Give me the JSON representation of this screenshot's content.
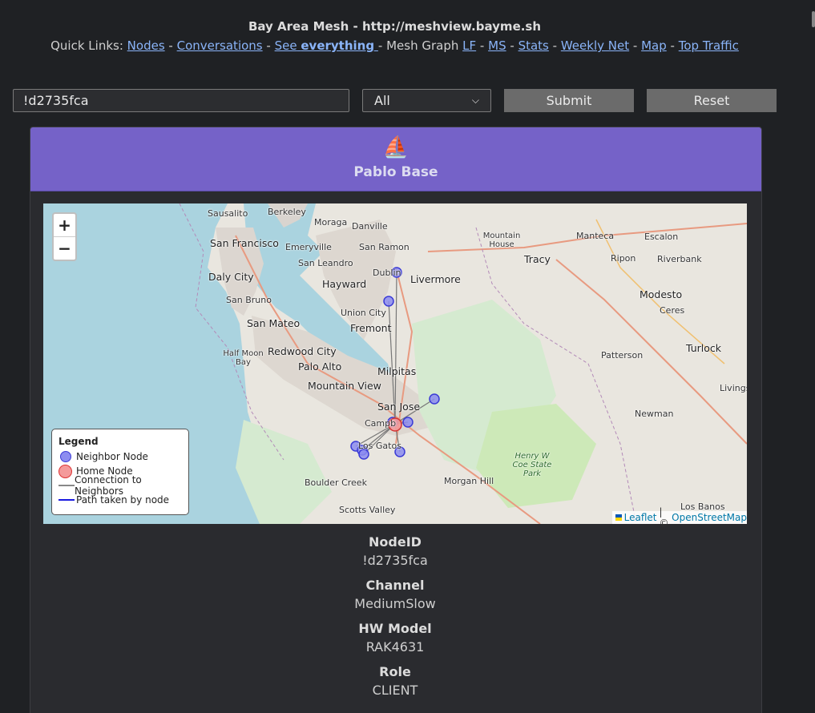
{
  "site": {
    "title": "Bay Area Mesh - http://meshview.bayme.sh",
    "quick_links_label": "Quick Links:",
    "links": {
      "nodes": "Nodes",
      "conversations": "Conversations",
      "see": "See",
      "everything": "everything",
      "mesh_graph": "Mesh Graph",
      "lf": "LF",
      "ms": "MS",
      "stats": "Stats",
      "weekly_net": "Weekly Net",
      "map": "Map",
      "top_traffic": "Top Traffic"
    },
    "separator": "-"
  },
  "search": {
    "value": "!d2735fca",
    "channel_selected": "All",
    "submit_label": "Submit",
    "reset_label": "Reset"
  },
  "node": {
    "icon": "⛵",
    "name": "Pablo Base",
    "fields": [
      {
        "label": "NodeID",
        "value": "!d2735fca"
      },
      {
        "label": "Channel",
        "value": "MediumSlow"
      },
      {
        "label": "HW Model",
        "value": "RAK4631"
      },
      {
        "label": "Role",
        "value": "CLIENT"
      }
    ]
  },
  "map": {
    "zoom_in": "+",
    "zoom_out": "−",
    "places": {
      "sausalito": "Sausalito",
      "berkeley": "Berkeley",
      "moraga": "Moraga",
      "danville": "Danville",
      "manteca": "Manteca",
      "escalon": "Escalon",
      "mountain_house": "Mountain House",
      "san_francisco": "San Francisco",
      "emeryville": "Emeryville",
      "san_ramon": "San Ramon",
      "tracy": "Tracy",
      "ripon": "Ripon",
      "riverbank": "Riverbank",
      "san_leandro": "San Leandro",
      "daly_city": "Daly City",
      "dublin": "Dublin",
      "livermore": "Livermore",
      "hayward": "Hayward",
      "modesto": "Modesto",
      "san_bruno": "San Bruno",
      "ceres": "Ceres",
      "union_city": "Union City",
      "san_mateo": "San Mateo",
      "fremont": "Fremont",
      "redwood_city": "Redwood City",
      "half_moon_bay": "Half Moon Bay",
      "turlock": "Turlock",
      "patterson": "Patterson",
      "palo_alto": "Palo Alto",
      "milpitas": "Milpitas",
      "mountain_view": "Mountain View",
      "livingston": "Livingst",
      "san_jose": "San Jose",
      "newman": "Newman",
      "campbell": "Campb",
      "los_gatos": "Los Gatos",
      "henry_coe": "Henry W Coe State Park",
      "morgan_hill": "Morgan Hill",
      "boulder_creek": "Boulder Creek",
      "scotts_valley": "Scotts Valley",
      "los_banos": "Los Banos"
    },
    "legend": {
      "title": "Legend",
      "neighbor": "Neighbor Node",
      "home": "Home Node",
      "connection": "Connection to Neighbors",
      "path": "Path taken by node"
    },
    "attribution": {
      "leaflet": "Leaflet",
      "sep": "| ©",
      "osm": "OpenStreetMap"
    },
    "colors": {
      "water": "#aad3df",
      "land": "#e9e6df",
      "urban": "#d9d4cf",
      "park": "#cde9b8",
      "neighbor_fill": "#8c8cf0",
      "neighbor_stroke": "#3b3bd6",
      "home_fill": "#f49a9a",
      "home_stroke": "#d33333"
    }
  }
}
